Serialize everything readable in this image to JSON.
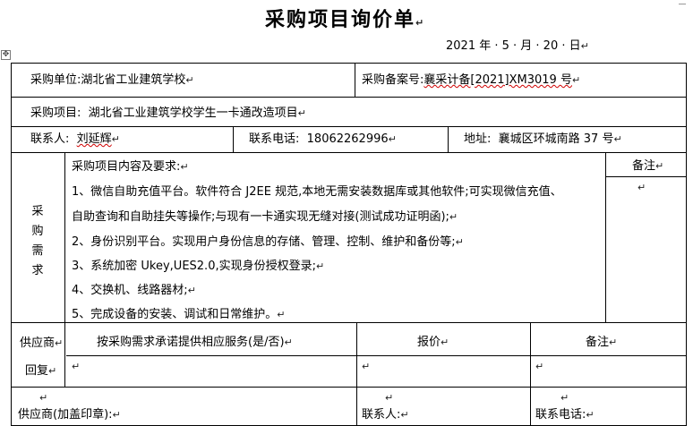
{
  "doc": {
    "title": "采购项目询价单",
    "date": "2021 年 · 5 · 月 · 20 · 日"
  },
  "row1": {
    "unit_label": "采购单位:",
    "unit_value": "湖北省工业建筑学校",
    "filing_label": "采购备案号:",
    "filing_value": "襄采计备[2021]XM3019 号"
  },
  "row2": {
    "project_label": "采购项目:",
    "project_value": "湖北省工业建筑学校学生一卡通改造项目"
  },
  "row3": {
    "contact_label": "联系人:",
    "contact_value": "刘延辉",
    "phone_label": "联系电话:",
    "phone_value": "18062262996",
    "address_label": "地址:",
    "address_value": "襄城区环城南路 37 号"
  },
  "requirements": {
    "side_label_chars": [
      "采",
      "购",
      "需",
      "求"
    ],
    "remark_header": "备注",
    "heading": "采购项目内容及要求:",
    "item1_line1": "1、微信自助充值平台。软件符合 J2EE 规范,本地无需安装数据库或其他软件;可实现微信充值、",
    "item1_line2": "自助查询和自助挂失等操作;与现有一卡通实现无缝对接(测试成功证明函);",
    "item2": "2、身份识别平台。实现用户身份信息的存储、管理、控制、维护和备份等;",
    "item3": "3、系统加密 Ukey,UES2.0,实现身份授权登录;",
    "item4": "4、交换机、线路器材;",
    "item5": "5、完成设备的安装、调试和日常维护。"
  },
  "reply": {
    "label_line1": "供应商",
    "label_line2": "回复",
    "col1_header": "按采购需求承诺提供相应服务(是/否)",
    "col2_header": "报价",
    "col3_header": "备注"
  },
  "footer": {
    "supplier_label": "供应商(加盖印章):",
    "contact_label": "联系人:",
    "phone_label": "联系电话:"
  },
  "marks": {
    "para": "↵",
    "move_handle": "✥"
  }
}
